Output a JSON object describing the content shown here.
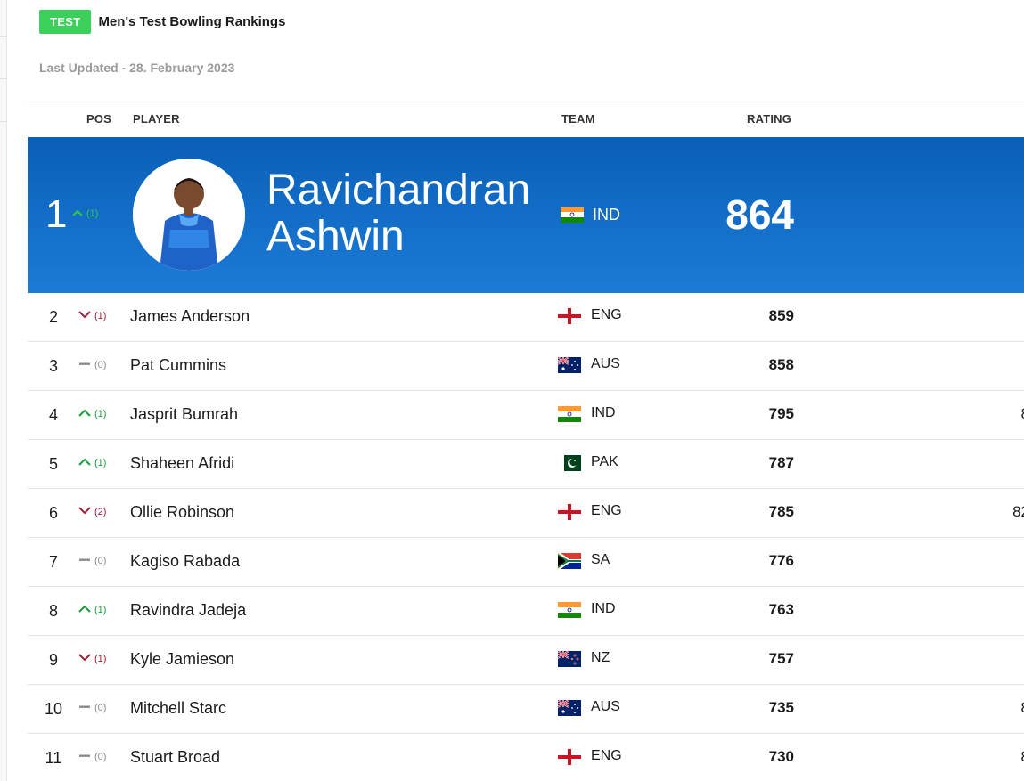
{
  "header": {
    "badge": "TEST",
    "title": "Men's Test Bowling Rankings",
    "last_updated": "Last Updated - 28. February 2023"
  },
  "columns": {
    "pos": "POS",
    "player": "PLAYER",
    "team": "TEAM",
    "rating": "RATING"
  },
  "top": {
    "pos": "1",
    "move_dir": "up",
    "move": "(1)",
    "name": "Ravichandran Ashwin",
    "team": "IND",
    "flag": "india",
    "rating": "864"
  },
  "rows": [
    {
      "pos": "2",
      "move_dir": "down",
      "move": "(1)",
      "name": "James Anderson",
      "team": "ENG",
      "flag": "england",
      "rating": "859",
      "extra": ""
    },
    {
      "pos": "3",
      "move_dir": "same",
      "move": "(0)",
      "name": "Pat Cummins",
      "team": "AUS",
      "flag": "australia",
      "rating": "858",
      "extra": ""
    },
    {
      "pos": "4",
      "move_dir": "up",
      "move": "(1)",
      "name": "Jasprit Bumrah",
      "team": "IND",
      "flag": "india",
      "rating": "795",
      "extra": "8"
    },
    {
      "pos": "5",
      "move_dir": "up",
      "move": "(1)",
      "name": "Shaheen Afridi",
      "team": "PAK",
      "flag": "pakistan",
      "rating": "787",
      "extra": ""
    },
    {
      "pos": "6",
      "move_dir": "down",
      "move": "(2)",
      "name": "Ollie Robinson",
      "team": "ENG",
      "flag": "england",
      "rating": "785",
      "extra": "82"
    },
    {
      "pos": "7",
      "move_dir": "same",
      "move": "(0)",
      "name": "Kagiso Rabada",
      "team": "SA",
      "flag": "southafrica",
      "rating": "776",
      "extra": ""
    },
    {
      "pos": "8",
      "move_dir": "up",
      "move": "(1)",
      "name": "Ravindra Jadeja",
      "team": "IND",
      "flag": "india",
      "rating": "763",
      "extra": ""
    },
    {
      "pos": "9",
      "move_dir": "down",
      "move": "(1)",
      "name": "Kyle Jamieson",
      "team": "NZ",
      "flag": "newzealand",
      "rating": "757",
      "extra": ""
    },
    {
      "pos": "10",
      "move_dir": "same",
      "move": "(0)",
      "name": "Mitchell Starc",
      "team": "AUS",
      "flag": "australia",
      "rating": "735",
      "extra": "8"
    },
    {
      "pos": "11",
      "move_dir": "same",
      "move": "(0)",
      "name": "Stuart Broad",
      "team": "ENG",
      "flag": "england",
      "rating": "730",
      "extra": "8"
    }
  ]
}
